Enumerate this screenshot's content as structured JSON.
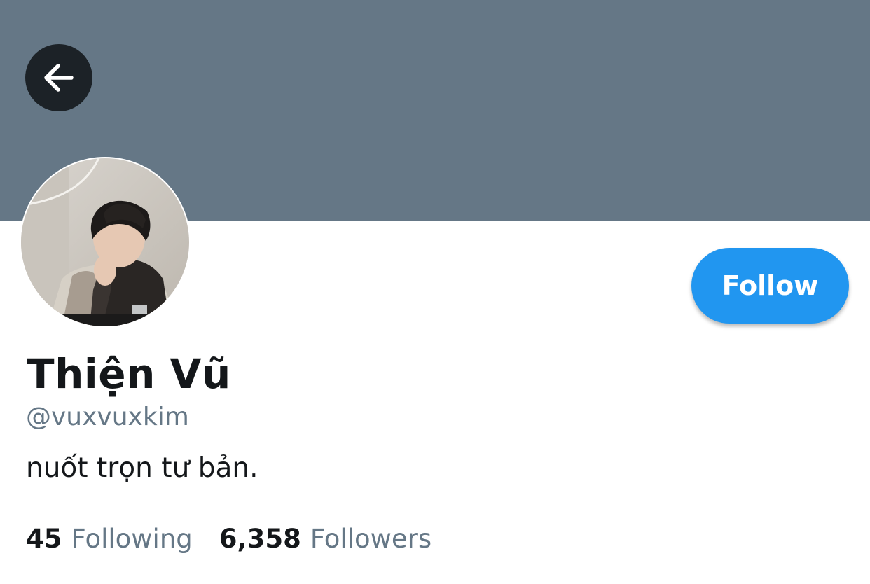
{
  "profile": {
    "display_name": "Thiện Vũ",
    "handle": "@vuxvuxkim",
    "bio": "nuốt trọn tư bản."
  },
  "actions": {
    "follow_label": "Follow"
  },
  "stats": {
    "following_count": "45",
    "following_label": "Following",
    "followers_count": "6,358",
    "followers_label": "Followers"
  },
  "icons": {
    "back": "arrow-left-icon"
  },
  "colors": {
    "banner": "#657786",
    "accent": "#2196f0",
    "back_button_bg": "#1c2227",
    "text_primary": "#14171a",
    "text_secondary": "#657786"
  }
}
